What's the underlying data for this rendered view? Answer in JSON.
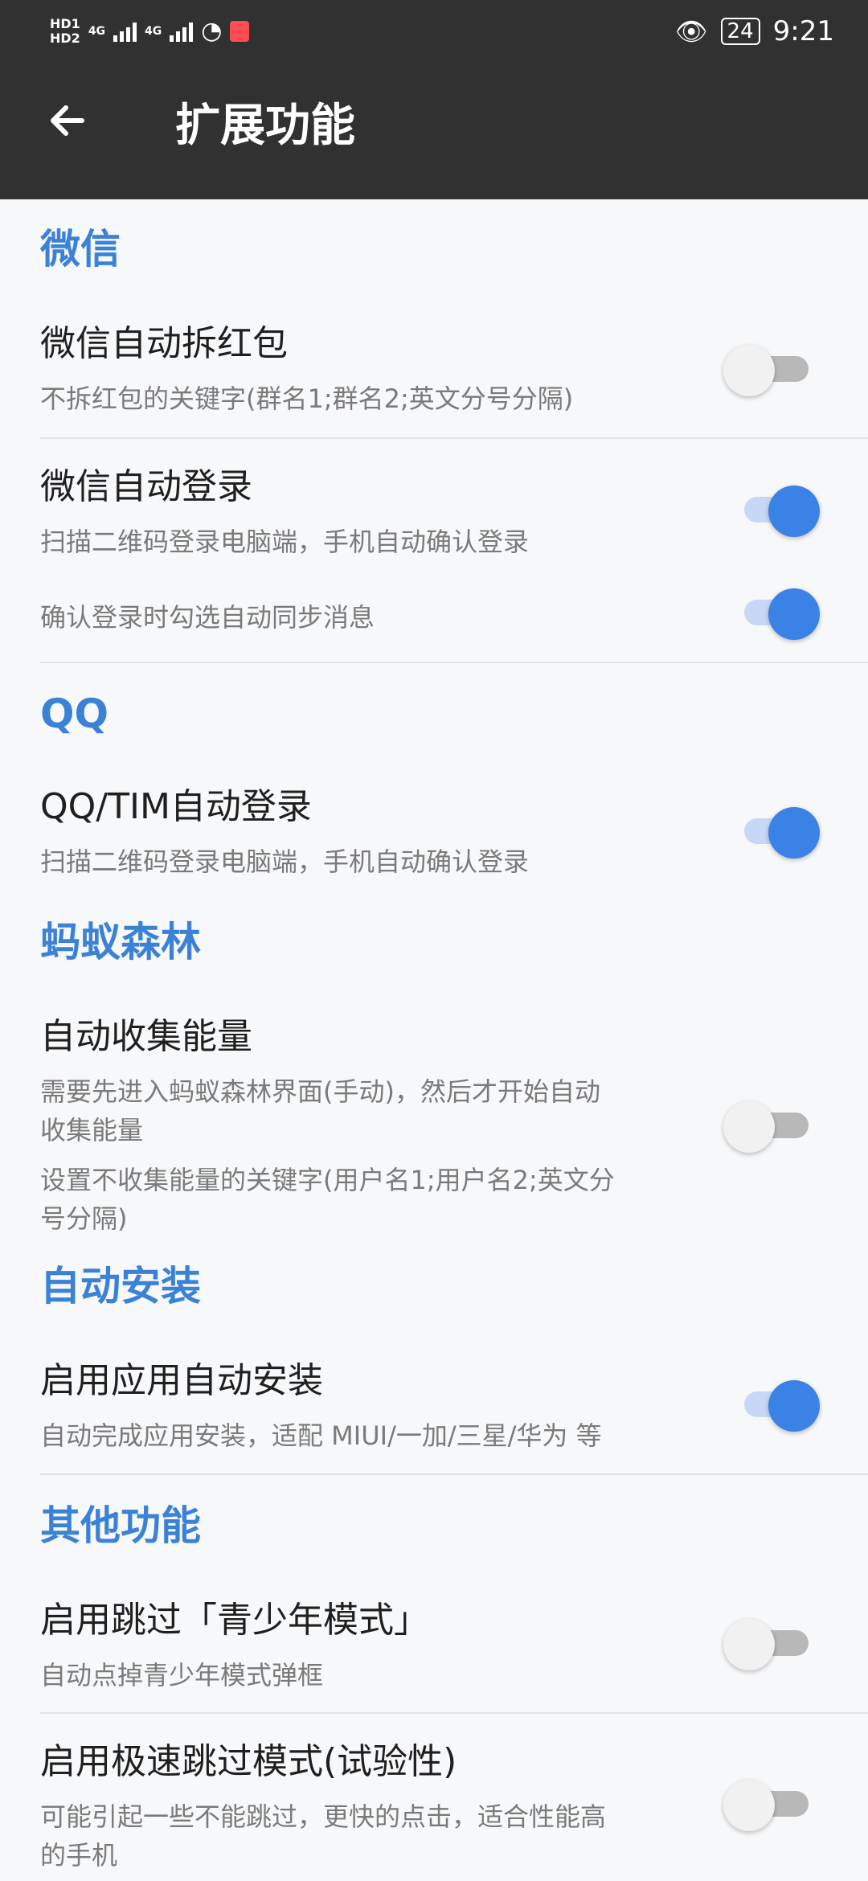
{
  "status_bar": {
    "hd1": "HD1",
    "hd2": "HD2",
    "net1": "4G",
    "net2": "4G",
    "battery": "24",
    "time": "9:21"
  },
  "app_bar": {
    "title": "扩展功能"
  },
  "sections": {
    "wechat": "微信",
    "qq": "QQ",
    "ant_forest": "蚂蚁森林",
    "auto_install": "自动安装",
    "other": "其他功能"
  },
  "rows": {
    "wechat_red_packet": {
      "title": "微信自动拆红包",
      "sub": "不拆红包的关键字(群名1;群名2;英文分号分隔)",
      "enabled": false
    },
    "wechat_login": {
      "title": "微信自动登录",
      "sub": "扫描二维码登录电脑端，手机自动确认登录",
      "enabled": true
    },
    "wechat_sync": {
      "sub": "确认登录时勾选自动同步消息",
      "enabled": true
    },
    "qq_login": {
      "title": "QQ/TIM自动登录",
      "sub": "扫描二维码登录电脑端，手机自动确认登录",
      "enabled": true
    },
    "collect_energy": {
      "title": "自动收集能量",
      "sub1_line1": "需要先进入蚂蚁森林界面(手动)，然后才开始自动",
      "sub1_line2": "收集能量",
      "sub2_line1": "设置不收集能量的关键字(用户名1;用户名2;英文分",
      "sub2_line2": "号分隔)",
      "enabled": false
    },
    "app_install": {
      "title": "启用应用自动安装",
      "sub": "自动完成应用安装，适配 MIUI/一加/三星/华为 等",
      "enabled": true
    },
    "skip_teen": {
      "title": "启用跳过「青少年模式」",
      "sub": "自动点掉青少年模式弹框",
      "enabled": false
    },
    "fast_skip": {
      "title": "启用极速跳过模式(试验性)",
      "sub_line1": "可能引起一些不能跳过，更快的点击，适合性能高",
      "sub_line2": "的手机",
      "enabled": false
    }
  }
}
